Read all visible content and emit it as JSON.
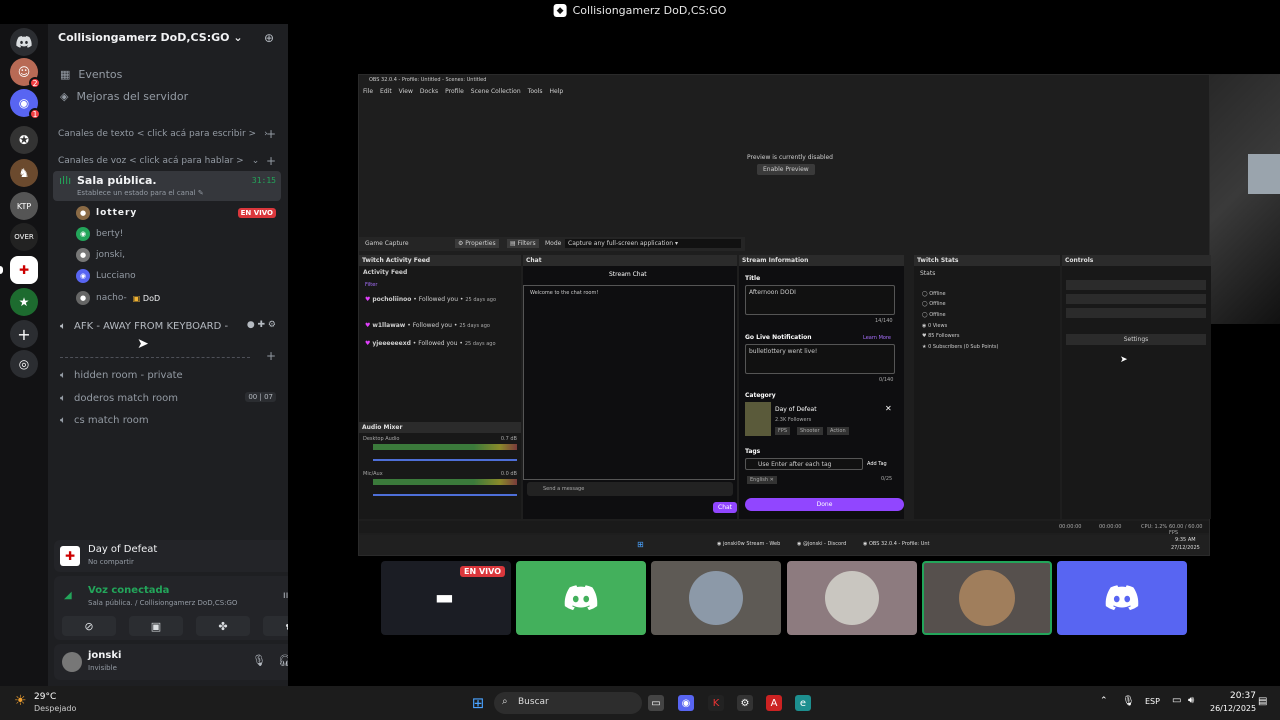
{
  "window_title": "Collisiongamerz DoD,CS:GO",
  "server": {
    "name": "Collisiongamerz DoD,CS:GO"
  },
  "nav": [
    {
      "label": "Eventos"
    },
    {
      "label": "Mejoras del servidor"
    }
  ],
  "categories": {
    "text": "Canales de texto < click acá para escribir >",
    "voice": "Canales de voz < click acá para hablar >"
  },
  "voice_channel": {
    "name": "Sala pública.",
    "status": "Establece un estado para el canal",
    "timer": "31:15"
  },
  "users": [
    {
      "name": "lottery",
      "live": "EN VIVO"
    },
    {
      "name": "berty!"
    },
    {
      "name": "jonski,"
    },
    {
      "name": "Lucciano"
    },
    {
      "name": "nacho-",
      "tag": "DoD"
    }
  ],
  "channels": [
    {
      "name": "AFK - AWAY FROM KEYBOARD -"
    },
    {
      "name": "hidden room - private"
    },
    {
      "name": "doderos match room",
      "c1": "00",
      "c2": "07"
    },
    {
      "name": "cs match room"
    }
  ],
  "activity": {
    "title": "Day of Defeat",
    "sub": "No compartir"
  },
  "voice": {
    "status": "Voz conectada",
    "where": "Sala pública. / Collisiongamerz DoD,CS:GO"
  },
  "me": {
    "name": "jonski",
    "status": "Invisible"
  },
  "obs": {
    "title": "OBS 32.0.4 - Profile: Untitled - Scenes: Untitled",
    "menu": [
      "File",
      "Edit",
      "View",
      "Docks",
      "Profile",
      "Scene Collection",
      "Tools",
      "Help"
    ],
    "preview_disabled": "Preview is currently disabled",
    "enable_preview": "Enable Preview",
    "source": "Game Capture",
    "properties": "Properties",
    "filters": "Filters",
    "mode_label": "Mode",
    "mode_value": "Capture any full-screen application",
    "activity_hdr": "Twitch Activity Feed",
    "activity_feed": "Activity Feed",
    "filter": "Filter",
    "events": [
      {
        "name": "pocholiinoo",
        "text": "• Followed you •",
        "time": "25 days ago"
      },
      {
        "name": "w1llawaw",
        "text": "• Followed you •",
        "time": "25 days ago"
      },
      {
        "name": "yjeeeeeexd",
        "text": "• Followed you •",
        "time": "25 days ago"
      }
    ],
    "chat_hdr": "Chat",
    "stream_chat": "Stream Chat",
    "welcome": "Welcome to the chat room!",
    "send": "Send a message",
    "chat_btn": "Chat",
    "mixer_hdr": "Audio Mixer",
    "desktop_audio": "Desktop Audio",
    "desktop_db": "0.7 dB",
    "mic": "Mic/Aux",
    "mic_db": "0.0 dB",
    "info_hdr": "Stream Information",
    "title_label": "Title",
    "title_value": "Afternoon DODI",
    "title_count": "14/140",
    "golive_label": "Go Live Notification",
    "learn_more": "Learn More",
    "golive_value": "bulletlottery went live!",
    "golive_count": "0/140",
    "category_label": "Category",
    "game": "Day of Defeat",
    "followers": "2.3K Followers",
    "tags_game": [
      "FPS",
      "Shooter",
      "Action"
    ],
    "tags_label": "Tags",
    "tags_placeholder": "Use Enter after each tag",
    "add_tag": "Add Tag",
    "tag": "English",
    "tag_count": "0/25",
    "done": "Done",
    "stats_hdr": "Twitch Stats",
    "stats": "Stats",
    "stat_rows": [
      "Offline",
      "Offline",
      "Offline",
      "0 Views",
      "85 Followers",
      "0 Subscribers (0 Sub Points)"
    ],
    "controls_hdr": "Controls",
    "settings": "Settings",
    "statusbar": {
      "t1": "00:00:00",
      "t2": "00:00:00",
      "cpu": "CPU: 1.2%",
      "fps": "60.00 / 60.00 FPS"
    },
    "inner_taskbar": {
      "a": "jonski0w Stream - Web",
      "b": "@jonski - Discord",
      "c": "OBS 32.0.4 - Profile: Unt",
      "time": "9:35 AM",
      "date": "27/12/2025"
    }
  },
  "tile_live": "EN VIVO",
  "taskbar": {
    "temp": "29°C",
    "weather": "Despejado",
    "search": "Buscar",
    "lang": "ESP",
    "time": "20:37",
    "date": "26/12/2025"
  }
}
